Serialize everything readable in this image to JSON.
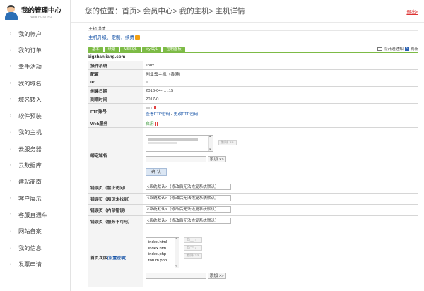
{
  "brand": {
    "title": "我的管理中心",
    "subtitle": "WEB HOSTING"
  },
  "sidebar": {
    "items": [
      {
        "label": "我的帐户"
      },
      {
        "label": "我的订单"
      },
      {
        "label": "幸手活动"
      },
      {
        "label": "我的域名"
      },
      {
        "label": "域名转入"
      },
      {
        "label": "软件预装"
      },
      {
        "label": "我的主机"
      },
      {
        "label": "云服务器"
      },
      {
        "label": "云数据库"
      },
      {
        "label": "建站商南"
      },
      {
        "label": "客户展示"
      },
      {
        "label": "客服直通车"
      },
      {
        "label": "网站备案"
      },
      {
        "label": "我的信息"
      },
      {
        "label": "发票申请"
      }
    ]
  },
  "header": {
    "breadcrumb": "您的位置：首页> 会员中心> 我的主机> 主机详情",
    "logout": "退出»"
  },
  "section": {
    "title": "主机详情",
    "links": {
      "upgrade": "主机升级、定制，续费",
      "sep": "、"
    }
  },
  "tabs": [
    {
      "label": "基本"
    },
    {
      "label": "续期"
    },
    {
      "label": "MSSQL"
    },
    {
      "label": "MySQL"
    },
    {
      "label": "控制面板"
    }
  ],
  "ops": {
    "notify": "需开通通知",
    "refresh": "刷新"
  },
  "host": {
    "name": "bigzhanjiang.com",
    "rows": {
      "os": {
        "k": "操作系统",
        "v": "linux"
      },
      "config": {
        "k": "配置",
        "v": "创业云主机（香港）"
      },
      "ip": {
        "k": "IP",
        "v": ""
      },
      "created": {
        "k": "创建日期",
        "v": "2016-04-… :15"
      },
      "expire": {
        "k": "到期时间",
        "v": "2017-0…"
      },
      "ftp": {
        "k": "FTP账号",
        "v": "",
        "link1": "查看FTP密码",
        "sep": " / ",
        "link2": "更改FTP密码"
      },
      "web": {
        "k": "Web服务",
        "v": "启用"
      },
      "domain": {
        "k": "绑定域名",
        "del": "删除 >>",
        "add": "添加 >>",
        "ok": "确 认"
      },
      "err403": {
        "k": "错误页（禁止访问）",
        "v": "<系统默认>（修改后无法恢复系统默认）"
      },
      "err404": {
        "k": "错误页（网页未找到）",
        "v": "<系统默认>（修改后无法恢复系统默认）"
      },
      "err500": {
        "k": "错误页（内部错误）",
        "v": "<系统默认>（修改后无法恢复系统默认）"
      },
      "err503": {
        "k": "错误页（服务不可用）",
        "v": "<系统默认>（修改后无法恢复系统默认）"
      },
      "index": {
        "k": "首页次序",
        "help": "(设置说明)",
        "files": [
          "index.html",
          "index.htm",
          "index.php",
          "forum.php"
        ],
        "up": "向上 ↑",
        "down": "向下 ↓",
        "del": "删除 >>",
        "add": "添加 >>"
      }
    }
  }
}
